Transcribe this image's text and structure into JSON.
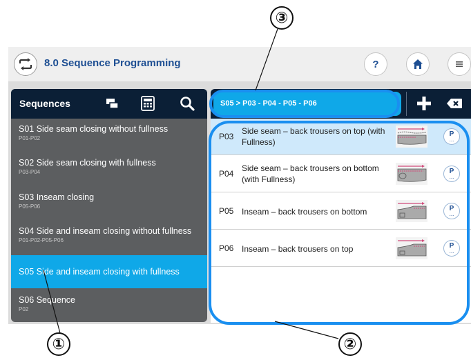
{
  "app": {
    "title": "8.0 Sequence Programming",
    "icons": {
      "app": "repeat-arrows-icon",
      "help": "question-icon",
      "home": "home-icon",
      "menu": "menu-lines-icon"
    },
    "help_label": "?"
  },
  "sequences_panel": {
    "title": "Sequences",
    "icons": [
      "copy-icon",
      "calculator-icon",
      "search-icon"
    ],
    "items": [
      {
        "title": "S01  Side seam closing without fullness",
        "sub": "P01-P02",
        "active": false
      },
      {
        "title": "S02  Side seam closing with fullness",
        "sub": "P03-P04",
        "active": false
      },
      {
        "title": "S03  Inseam closing",
        "sub": "P05-P06",
        "active": false
      },
      {
        "title": "S04  Side and inseam closing without fullness",
        "sub": "P01-P02-P05-P06",
        "active": false
      },
      {
        "title": "S05  Side and inseam closing with fullness",
        "sub": "",
        "active": true
      },
      {
        "title": "S06  Sequence",
        "sub": "P02",
        "active": false
      }
    ]
  },
  "detail_panel": {
    "breadcrumb": "S05 > P03 - P04 - P05 - P06",
    "icons": [
      "plus-icon",
      "backspace-icon"
    ],
    "programs": [
      {
        "id": "P03",
        "text": "Side seam – back trousers on top (with Fullness)",
        "selected": true,
        "button": "P"
      },
      {
        "id": "P04",
        "text": "Side seam – back trousers on bottom (with Fullness)",
        "selected": false,
        "button": "P"
      },
      {
        "id": "P05",
        "text": "Inseam – back trousers on bottom",
        "selected": false,
        "button": "P"
      },
      {
        "id": "P06",
        "text": "Inseam – back trousers on top",
        "selected": false,
        "button": "P"
      }
    ]
  },
  "callouts": [
    "①",
    "②",
    "③"
  ],
  "colors": {
    "accent": "#0fa8e8",
    "header": "#0b1f36",
    "panel": "#5c5e60",
    "title": "#1e4f93",
    "highlight": "#1a8ff0"
  }
}
